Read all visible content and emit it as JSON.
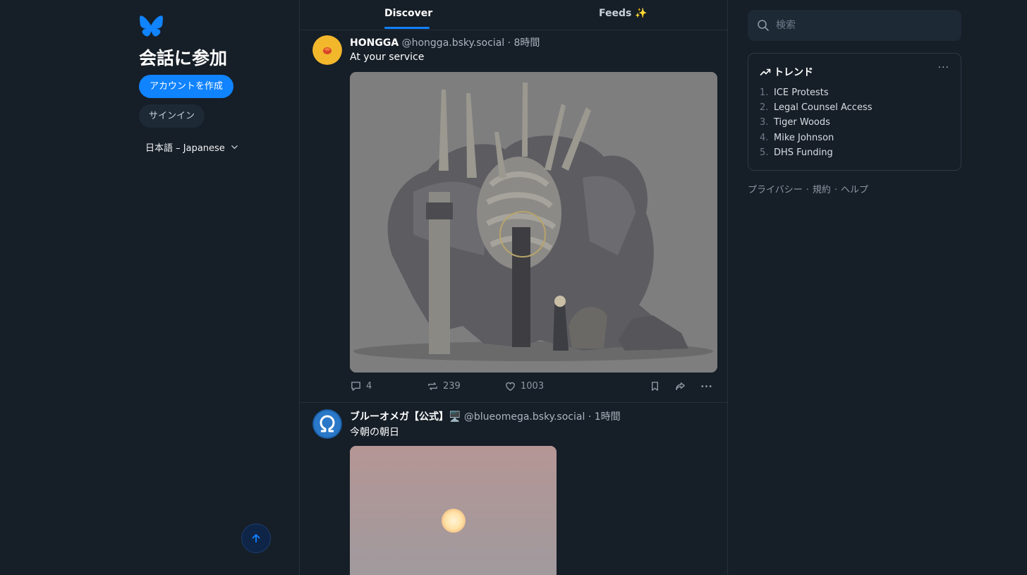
{
  "sidebar": {
    "logo_icon": "butterfly-icon",
    "join_title": "会話に参加",
    "create_account_label": "アカウントを作成",
    "sign_in_label": "サインイン",
    "language_label": "日本語 – Japanese",
    "scroll_top_icon": "arrow-up-icon"
  },
  "tabs": [
    {
      "label": "Discover",
      "active": true
    },
    {
      "label": "Feeds ✨",
      "active": false
    }
  ],
  "posts": [
    {
      "display_name": "HONGGA",
      "handle": "@hongga.bsky.social",
      "time": "· 8時間",
      "text": "At your service",
      "replies": "4",
      "reposts": "239",
      "likes": "1003"
    },
    {
      "display_name": "ブルーオメガ【公式】🖥️",
      "handle": "@blueomega.bsky.social",
      "time": "· 1時間",
      "text": "今朝の朝日"
    }
  ],
  "search": {
    "placeholder": "検索"
  },
  "trends": {
    "title": "トレンド",
    "more": "···",
    "items": [
      {
        "num": "1.",
        "label": "ICE Protests"
      },
      {
        "num": "2.",
        "label": "Legal Counsel Access"
      },
      {
        "num": "3.",
        "label": "Tiger Woods"
      },
      {
        "num": "4.",
        "label": "Mike Johnson"
      },
      {
        "num": "5.",
        "label": "DHS Funding"
      }
    ]
  },
  "footer": {
    "privacy": "プライバシー",
    "terms": "規約",
    "help": "ヘルプ",
    "separator": "·"
  },
  "colors": {
    "background": "#161e27",
    "accent": "#1083fe",
    "border": "#26313d"
  }
}
